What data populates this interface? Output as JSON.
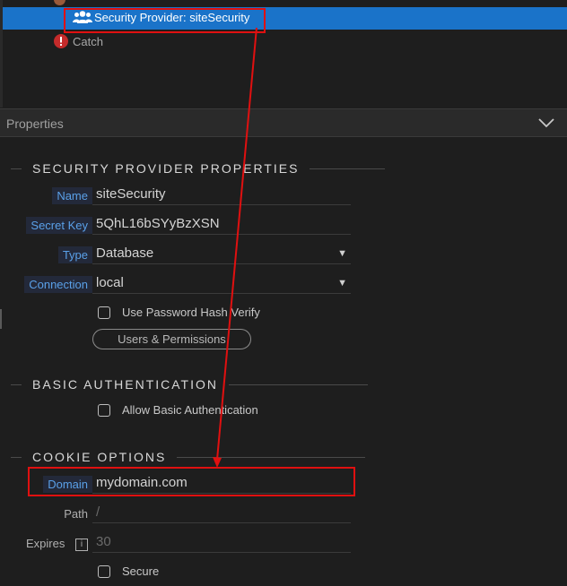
{
  "tree": {
    "selected_item": "Security Provider: siteSecurity",
    "catch_item": "Catch"
  },
  "properties": {
    "title": "Properties"
  },
  "sections": {
    "security_provider": "SECURITY PROVIDER PROPERTIES",
    "basic_auth": "BASIC AUTHENTICATION",
    "cookie": "COOKIE OPTIONS"
  },
  "fields": {
    "name": {
      "label": "Name",
      "value": "siteSecurity"
    },
    "secret_key": {
      "label": "Secret Key",
      "value": "5QhL16bSYyBzXSN"
    },
    "type": {
      "label": "Type",
      "value": "Database"
    },
    "connection": {
      "label": "Connection",
      "value": "local"
    },
    "password_hash": {
      "label": "Use Password Hash Verify"
    },
    "users_button": {
      "label": "Users & Permissions"
    },
    "allow_basic": {
      "label": "Allow Basic Authentication"
    },
    "domain": {
      "label": "Domain",
      "value": "mydomain.com"
    },
    "path": {
      "label": "Path",
      "placeholder": "/"
    },
    "expires": {
      "label": "Expires",
      "placeholder": "30"
    },
    "secure": {
      "label": "Secure"
    }
  },
  "colors": {
    "selection": "#1a73c9",
    "highlight": "#e01010",
    "label_blue": "#5aa0e8"
  },
  "icons": {
    "provider": "users-icon",
    "catch": "error-icon",
    "collapse": "chevron-down-icon",
    "info": "info-icon"
  }
}
